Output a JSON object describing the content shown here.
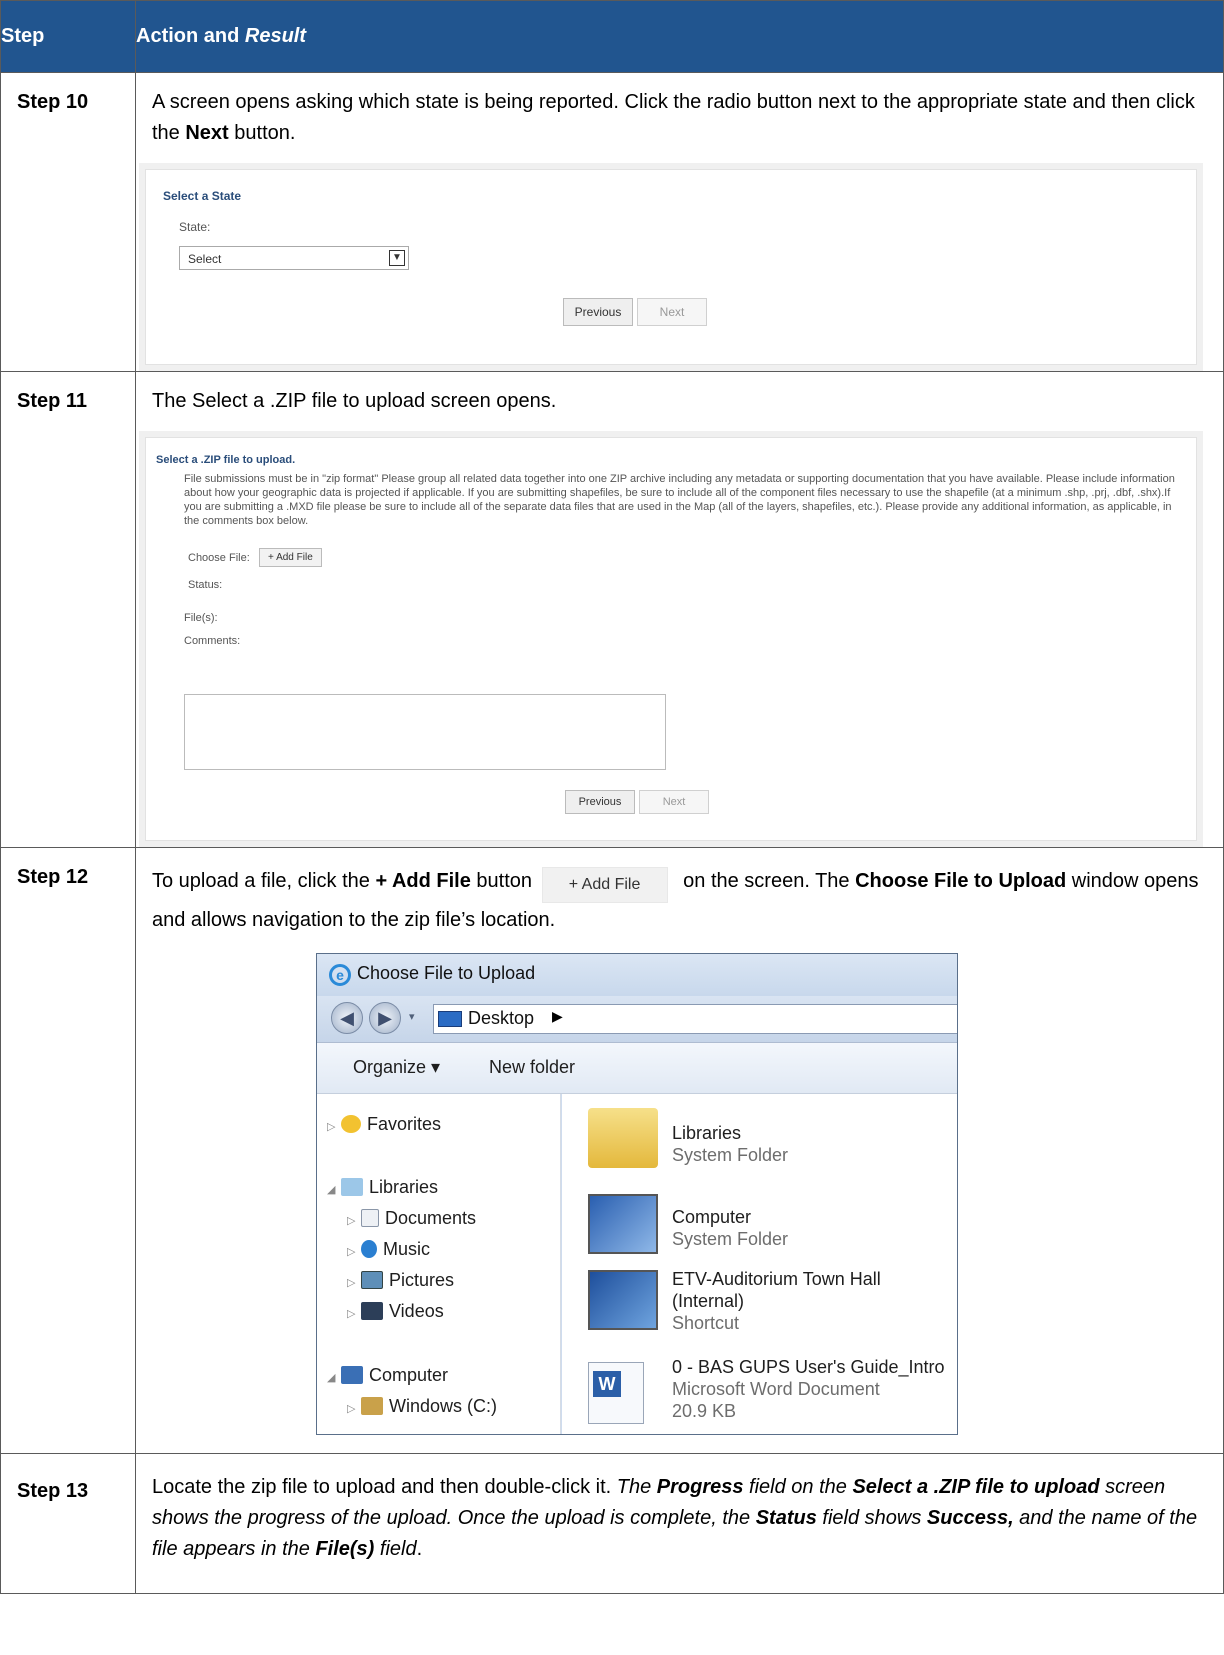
{
  "table": {
    "header_step": "Step",
    "header_action": "Action and ",
    "header_result": "Result"
  },
  "rows": [
    {
      "step": "Step 10",
      "text_before": "A screen opens asking which state is being reported. Click the radio button next to the appropriate state and then click the ",
      "text_bold": "Next",
      "text_after": " button.",
      "shot": {
        "title": "Select a State",
        "state_label": "State:",
        "select_value": "Select",
        "previous": "Previous",
        "next": "Next"
      }
    },
    {
      "step": "Step 11",
      "text": "The Select a .ZIP file to upload screen opens.",
      "shot": {
        "title": "Select a .ZIP file to upload.",
        "paragraph": "File submissions must be in \"zip format\" Please group all related data together into one ZIP archive including any metadata or supporting documentation that you have available. Please include information about how your geographic data is projected if applicable. If you are submitting shapefiles, be sure to include all of the component files necessary to use the shapefile (at a minimum .shp, .prj, .dbf, .shx).If you are submitting a .MXD file please be sure to include all of the separate data files that are used in the Map (all of the layers, shapefiles, etc.). Please provide any additional information, as applicable, in the comments box below.",
        "choose_file_label": "Choose File:",
        "add_file": "+ Add File",
        "status_label": "Status:",
        "files_label": "File(s):",
        "comments_label": "Comments:",
        "previous": "Previous",
        "next": "Next"
      }
    },
    {
      "step": "Step 12",
      "t1": "To upload a file, click the ",
      "t2": "+ Add File",
      "t3": " button ",
      "inline_button": "+ Add File",
      "t4": " on the screen. The ",
      "t5": "Choose File to Upload",
      "t6": " window opens and allows navigation to the zip file’s location.",
      "dialog": {
        "title": "Choose File to Upload",
        "address": "Desktop",
        "organize": "Organize ▾",
        "new_folder": "New folder",
        "tree": {
          "favorites": "Favorites",
          "libraries": "Libraries",
          "documents": "Documents",
          "music": "Music",
          "pictures": "Pictures",
          "videos": "Videos",
          "computer": "Computer",
          "windows_c": "Windows (C:)"
        },
        "items": [
          {
            "name": "Libraries",
            "sub1": "System Folder",
            "sub2": "",
            "sub3": ""
          },
          {
            "name": "Computer",
            "sub1": "System Folder",
            "sub2": "",
            "sub3": ""
          },
          {
            "name": "ETV-Auditorium Town Hall",
            "sub1": "(Internal)",
            "sub2": "Shortcut",
            "sub3": ""
          },
          {
            "name": "0 - BAS GUPS User's Guide_Intro",
            "sub1": "Microsoft Word Document",
            "sub2": "20.9 KB",
            "sub3": ""
          }
        ]
      }
    },
    {
      "step": "Step 13",
      "a": "Locate the zip file to upload and then double-click it. ",
      "b": "The ",
      "c": "Progress",
      "d": " field on the ",
      "e": "Select a .ZIP file to upload",
      "f": " screen shows the progress of the upload. Once the upload is complete, the ",
      "g": "Status",
      "h": " field shows ",
      "i": "Success,",
      "j": " and the name of the file appears in the ",
      "k": "File(s)",
      "l": " field",
      "m": "."
    }
  ]
}
